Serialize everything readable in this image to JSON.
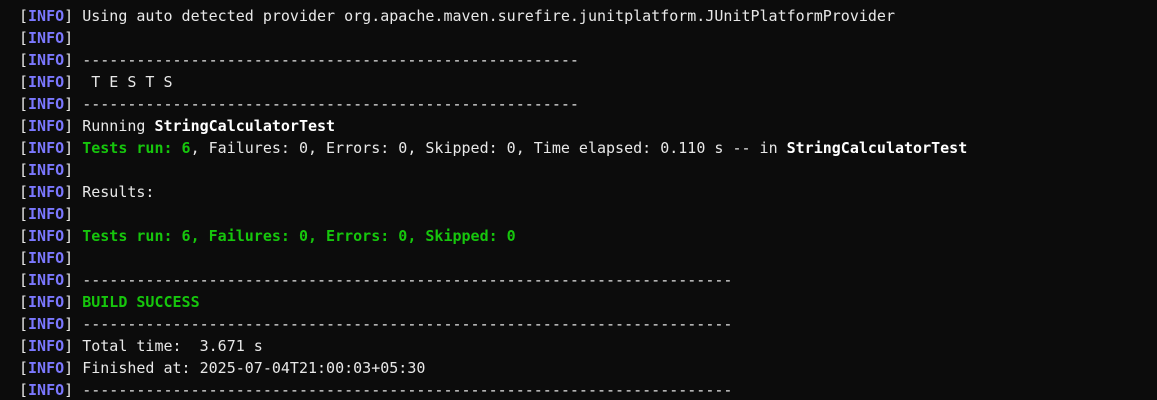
{
  "terminal": {
    "lines": [
      {
        "level": "INFO",
        "segments": [
          {
            "text": "Using auto detected provider org.apache.maven.surefire.junitplatform.JUnitPlatformProvider",
            "style": "plain"
          }
        ]
      },
      {
        "level": "INFO",
        "segments": []
      },
      {
        "level": "INFO",
        "segments": [
          {
            "text": "-------------------------------------------------------",
            "style": "plain"
          }
        ]
      },
      {
        "level": "INFO",
        "segments": [
          {
            "text": " T E S T S",
            "style": "plain"
          }
        ]
      },
      {
        "level": "INFO",
        "segments": [
          {
            "text": "-------------------------------------------------------",
            "style": "plain"
          }
        ]
      },
      {
        "level": "INFO",
        "segments": [
          {
            "text": "Running ",
            "style": "plain"
          },
          {
            "text": "StringCalculatorTest",
            "style": "bold"
          }
        ]
      },
      {
        "level": "INFO",
        "segments": [
          {
            "text": "Tests run: 6",
            "style": "green"
          },
          {
            "text": ", Failures: 0, Errors: 0, Skipped: 0, Time elapsed: 0.110 s -- in ",
            "style": "plain"
          },
          {
            "text": "StringCalculatorTest",
            "style": "bold"
          }
        ]
      },
      {
        "level": "INFO",
        "segments": []
      },
      {
        "level": "INFO",
        "segments": [
          {
            "text": "Results:",
            "style": "plain"
          }
        ]
      },
      {
        "level": "INFO",
        "segments": []
      },
      {
        "level": "INFO",
        "segments": [
          {
            "text": "Tests run: 6, Failures: 0, Errors: 0, Skipped: 0",
            "style": "green"
          }
        ]
      },
      {
        "level": "INFO",
        "segments": []
      },
      {
        "level": "INFO",
        "segments": [
          {
            "text": "------------------------------------------------------------------------",
            "style": "plain"
          }
        ]
      },
      {
        "level": "INFO",
        "segments": [
          {
            "text": "BUILD SUCCESS",
            "style": "green"
          }
        ]
      },
      {
        "level": "INFO",
        "segments": [
          {
            "text": "------------------------------------------------------------------------",
            "style": "plain"
          }
        ]
      },
      {
        "level": "INFO",
        "segments": [
          {
            "text": "Total time:  3.671 s",
            "style": "plain"
          }
        ]
      },
      {
        "level": "INFO",
        "segments": [
          {
            "text": "Finished at: 2025-07-04T21:00:03+05:30",
            "style": "plain"
          }
        ]
      },
      {
        "level": "INFO",
        "segments": [
          {
            "text": "------------------------------------------------------------------------",
            "style": "plain"
          }
        ]
      }
    ]
  },
  "colors": {
    "background": "#0c0c0c",
    "info_tag": "#7b78ff",
    "success_green": "#16c60c",
    "text": "#e8e8e8"
  }
}
